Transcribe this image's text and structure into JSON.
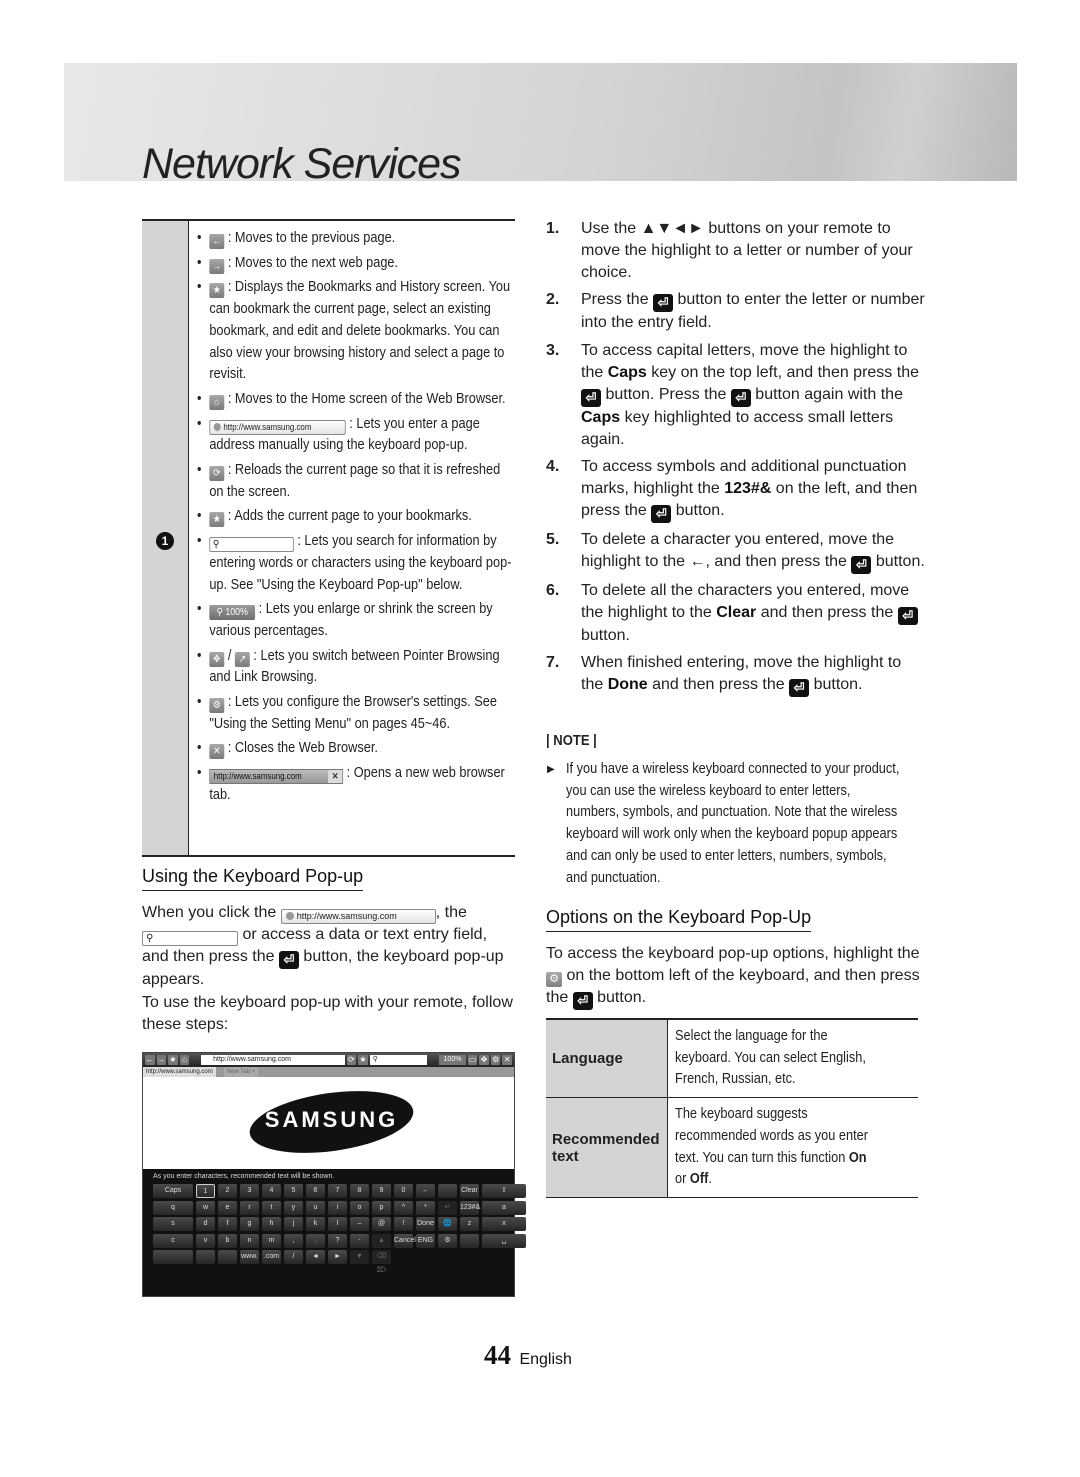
{
  "header": {
    "title": "Network Services"
  },
  "left_table": {
    "row_number": "1",
    "items": [
      {
        "icon": "back-arrow-icon",
        "glyph": "←",
        "text": " : Moves to the previous page."
      },
      {
        "icon": "forward-arrow-icon",
        "glyph": "→",
        "text": " : Moves to the next web page."
      },
      {
        "icon": "bookmarks-star-icon",
        "glyph": "★",
        "text": " : Displays the Bookmarks and History screen. You can bookmark the current page, select an existing bookmark, and edit and delete bookmarks. You can also view your browsing history and select a page to revisit."
      },
      {
        "icon": "home-icon",
        "glyph": "⌂",
        "text": " : Moves to the Home screen of the Web Browser."
      },
      {
        "icon": "url-field",
        "url": "http://www.samsung.com",
        "text": " : Lets you enter a page address manually using the keyboard pop-up."
      },
      {
        "icon": "reload-icon",
        "glyph": "⟳",
        "text": " : Reloads the current page so that it is refreshed on the screen."
      },
      {
        "icon": "add-bookmark-icon",
        "glyph": "★",
        "text": " : Adds the current page to your bookmarks."
      },
      {
        "icon": "search-field",
        "glyph": "⚲",
        "text": " : Lets you search for information by entering words or characters using the keyboard pop-up. See \"Using the Keyboard Pop-up\" below."
      },
      {
        "icon": "zoom-badge",
        "label": "⚲ 100%",
        "text": " : Lets you enlarge or shrink the screen by various percentages."
      },
      {
        "icon": "pointer-link-icons",
        "glyph": "✥",
        "glyph2": "↗",
        "sep": " / ",
        "text": " : Lets you switch between Pointer Browsing and Link Browsing."
      },
      {
        "icon": "settings-gear-icon",
        "glyph": "⚙",
        "text": " : Lets you configure the Browser's settings. See \"Using the Setting Menu\" on pages 45~46."
      },
      {
        "icon": "close-icon",
        "glyph": "✕",
        "text": " : Closes the Web Browser."
      },
      {
        "icon": "new-tab-badge",
        "url": "http://www.samsung.com",
        "x": "✕",
        "text": " : Opens a new web browser tab."
      }
    ]
  },
  "keyboard_section": {
    "heading": "Using the Keyboard Pop-up",
    "para1_a": "When you click the ",
    "para1_url": "http://www.samsung.com",
    "para1_b": ", the ",
    "para1_c": " or access a data or text entry field, and then press the ",
    "para1_d": " button, the keyboard pop-up appears.",
    "para2": "To use the keyboard pop-up with your remote, follow these steps:"
  },
  "browser_screenshot": {
    "url": "http://www.samsung.com",
    "zoom": "100%",
    "tab1": "http://www.samsung.com",
    "tab2": "New Tab +",
    "logo": "SAMSUNG",
    "hint": "As you enter characters, recommended text will be shown.",
    "keys": [
      [
        "Caps",
        "1",
        "2",
        "3",
        "4",
        "5",
        "6",
        "7",
        "8",
        "9",
        "0",
        "←",
        "",
        "Clear"
      ],
      [
        "⇧",
        "q",
        "w",
        "e",
        "r",
        "t",
        "y",
        "u",
        "i",
        "o",
        "p",
        "^",
        "*",
        "↵"
      ],
      [
        "123#&",
        "a",
        "s",
        "d",
        "f",
        "g",
        "h",
        "j",
        "k",
        "l",
        "–",
        "@",
        "!",
        "Done"
      ],
      [
        "🌐",
        "z",
        "x",
        "c",
        "v",
        "b",
        "n",
        "m",
        ",",
        ".",
        "?",
        "-",
        "▲",
        "Cancel"
      ],
      [
        "ENG",
        "⚙",
        "",
        "␣",
        "",
        "",
        "",
        "www.",
        ".com",
        "/",
        "◄",
        "►",
        "▼",
        "⌫ ⌦"
      ]
    ],
    "highlighted_key": "1"
  },
  "steps": [
    {
      "n": "1.",
      "parts": [
        "Use the ▲▼◄► buttons on your remote to move the highlight to a letter or number of your choice."
      ]
    },
    {
      "n": "2.",
      "parts": [
        "Press the ",
        "{E}",
        " button to enter the letter or number into the entry field."
      ]
    },
    {
      "n": "3.",
      "parts": [
        "To access capital letters, move the highlight to the ",
        "{B:Caps}",
        " key on the top left, and then press the ",
        "{E}",
        " button. Press the ",
        "{E}",
        " button again with the ",
        "{B:Caps}",
        " key highlighted to access small letters again."
      ]
    },
    {
      "n": "4.",
      "parts": [
        "To access symbols and additional punctuation marks, highlight the ",
        "{B:123#&}",
        " on the left, and then press the ",
        "{E}",
        " button."
      ]
    },
    {
      "n": "5.",
      "parts": [
        "To delete a character you entered, move the highlight to the ←, and then press the ",
        "{E}",
        " button."
      ]
    },
    {
      "n": "6.",
      "parts": [
        "To delete all the characters you entered, move the highlight to the ",
        "{B:Clear}",
        " and then press the ",
        "{E}",
        " button."
      ]
    },
    {
      "n": "7.",
      "parts": [
        "When finished entering, move the highlight to the ",
        "{B:Done}",
        " and then press the ",
        "{E}",
        " button."
      ]
    }
  ],
  "note": {
    "title": "| NOTE |",
    "text": "If you have a wireless keyboard connected to your product, you can use the wireless keyboard to enter letters, numbers, symbols, and punctuation. Note that the wireless keyboard will work only when the keyboard popup appears and can only be used to enter letters, numbers, symbols, and punctuation."
  },
  "options_section": {
    "heading": "Options on the Keyboard Pop-Up",
    "para_a": "To access the keyboard pop-up options, highlight the ",
    "para_b": " on the bottom left of the keyboard, and then press the ",
    "para_c": " button.",
    "rows": [
      {
        "key": "Language",
        "value": "Select the language for the keyboard. You can select English, French, Russian, etc."
      },
      {
        "key": "Recommended text",
        "value_a": "The keyboard suggests recommended words as you enter text. You can turn this function ",
        "on": "On",
        "or": " or ",
        "off": "Off",
        "end": "."
      }
    ]
  },
  "footer": {
    "page": "44",
    "language": "English"
  },
  "enter_glyph": "⏎"
}
